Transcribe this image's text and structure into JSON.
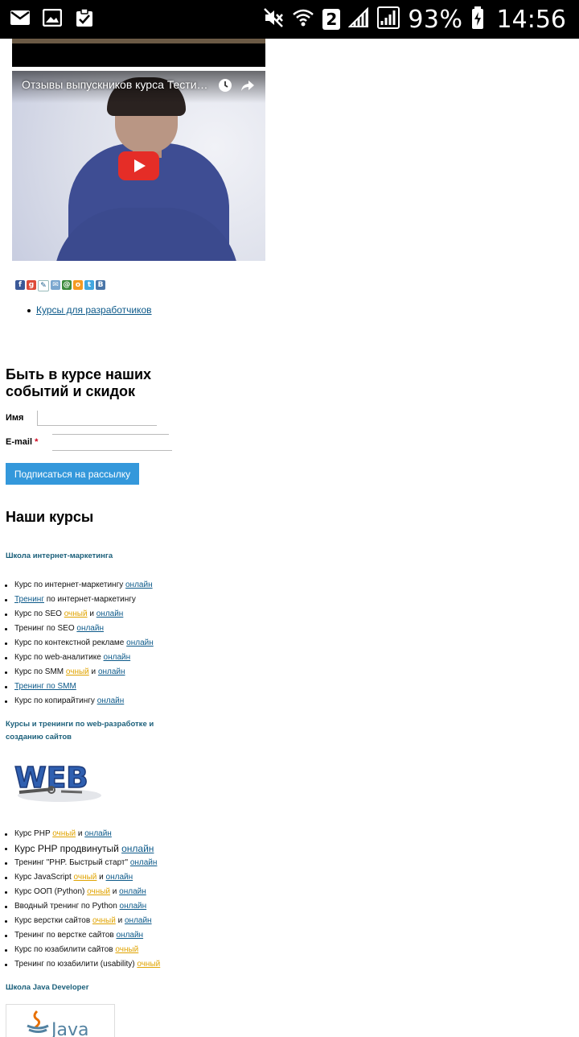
{
  "status_bar": {
    "battery": "93%",
    "time": "14:56",
    "sim": "2"
  },
  "video": {
    "title": "Отзывы выпускников курса Тестир..."
  },
  "dev_courses_link": "Курсы для разработчиков",
  "newsletter": {
    "title": "Быть в курсе наших событий и скидок",
    "name_label": "Имя",
    "email_label": "E-mail",
    "required_mark": "*",
    "name_value": "",
    "email_value": "",
    "button": "Подписаться на рассылку"
  },
  "courses": {
    "title": "Наши курсы",
    "sections": [
      {
        "heading": "Школа интернет-маркетинга",
        "items": [
          {
            "parts": [
              {
                "t": "Курс по интернет-маркетингу ",
                "s": "plain"
              },
              {
                "t": "онлайн",
                "s": "link"
              }
            ]
          },
          {
            "parts": [
              {
                "t": "Тренинг",
                "s": "link"
              },
              {
                "t": " по интернет-маркетингу",
                "s": "plain"
              }
            ]
          },
          {
            "parts": [
              {
                "t": "Курс по SEO ",
                "s": "plain"
              },
              {
                "t": "очный",
                "s": "orange"
              },
              {
                "t": " и ",
                "s": "plain"
              },
              {
                "t": "онлайн",
                "s": "link"
              }
            ]
          },
          {
            "parts": [
              {
                "t": "Тренинг по SEO ",
                "s": "plain"
              },
              {
                "t": "онлайн",
                "s": "link"
              }
            ]
          },
          {
            "parts": [
              {
                "t": "Курс по контекстной рекламе ",
                "s": "plain"
              },
              {
                "t": "онлайн",
                "s": "link"
              }
            ]
          },
          {
            "parts": [
              {
                "t": "Курс по web-аналитике ",
                "s": "plain"
              },
              {
                "t": "онлайн",
                "s": "link"
              }
            ]
          },
          {
            "parts": [
              {
                "t": "Курс по SMM ",
                "s": "plain"
              },
              {
                "t": "очный",
                "s": "orange"
              },
              {
                "t": " и ",
                "s": "plain"
              },
              {
                "t": "онлайн",
                "s": "link"
              }
            ]
          },
          {
            "parts": [
              {
                "t": "Тренинг по SMM",
                "s": "link"
              }
            ]
          },
          {
            "parts": [
              {
                "t": "Курс по копирайтингу ",
                "s": "plain"
              },
              {
                "t": "онлайн",
                "s": "link"
              }
            ]
          }
        ]
      },
      {
        "heading": "Курсы и тренинги по web-разработке и созданию сайтов",
        "logo_text": "WEB",
        "items": [
          {
            "parts": [
              {
                "t": "Курс PHP ",
                "s": "plain"
              },
              {
                "t": "очный",
                "s": "orange"
              },
              {
                "t": " и ",
                "s": "plain"
              },
              {
                "t": "онлайн",
                "s": "link"
              }
            ]
          },
          {
            "big": true,
            "parts": [
              {
                "t": "Курс PHP ",
                "s": "plain"
              },
              {
                "t": "продвинутый ",
                "s": "plain"
              },
              {
                "t": "онлайн",
                "s": "link"
              }
            ]
          },
          {
            "parts": [
              {
                "t": "Тренинг \"PHP. Быстрый старт\" ",
                "s": "plain"
              },
              {
                "t": "онлайн",
                "s": "link"
              }
            ]
          },
          {
            "parts": [
              {
                "t": "Курс JavaScript ",
                "s": "plain"
              },
              {
                "t": "очный",
                "s": "orange"
              },
              {
                "t": " и ",
                "s": "plain"
              },
              {
                "t": "онлайн",
                "s": "link"
              }
            ]
          },
          {
            "parts": [
              {
                "t": "Курс ООП (Python) ",
                "s": "plain"
              },
              {
                "t": "очный",
                "s": "orange"
              },
              {
                "t": " и ",
                "s": "plain"
              },
              {
                "t": "онлайн",
                "s": "link"
              }
            ]
          },
          {
            "parts": [
              {
                "t": "Вводный тренинг по Python ",
                "s": "plain"
              },
              {
                "t": "онлайн",
                "s": "link"
              }
            ]
          },
          {
            "parts": [
              {
                "t": "Курс верстки сайтов ",
                "s": "plain"
              },
              {
                "t": "очный",
                "s": "orange"
              },
              {
                "t": " и ",
                "s": "plain"
              },
              {
                "t": "онлайн",
                "s": "link"
              }
            ]
          },
          {
            "parts": [
              {
                "t": "Тренинг по верстке сайтов ",
                "s": "plain"
              },
              {
                "t": "онлайн",
                "s": "link"
              }
            ]
          },
          {
            "parts": [
              {
                "t": "Курс по юзабилити сайтов ",
                "s": "plain"
              },
              {
                "t": "очный",
                "s": "orange"
              }
            ]
          },
          {
            "parts": [
              {
                "t": "Тренинг по юзабилити (usability) ",
                "s": "plain"
              },
              {
                "t": "очный",
                "s": "orange"
              }
            ]
          }
        ]
      },
      {
        "heading": "Школа Java Developer",
        "logo_text": "Java"
      }
    ]
  },
  "colors": {
    "link": "#0d5a8a",
    "orange_link": "#e0a300",
    "section_heading": "#1a5f7a",
    "button": "#3498db",
    "youtube_red": "#e52d27"
  },
  "icons": {
    "status_left": [
      "mail-icon",
      "image-icon",
      "clipboard-check-icon"
    ],
    "status_right": [
      "mute-icon",
      "wifi-icon",
      "sim-icon",
      "signal-icon",
      "signal-box-icon",
      "battery-charging-icon"
    ],
    "share": [
      "facebook-icon",
      "google-plus-icon",
      "livejournal-icon",
      "odnoklassniki-alt-icon",
      "odnoklassniki-icon",
      "twitter-icon",
      "vk-icon"
    ]
  }
}
